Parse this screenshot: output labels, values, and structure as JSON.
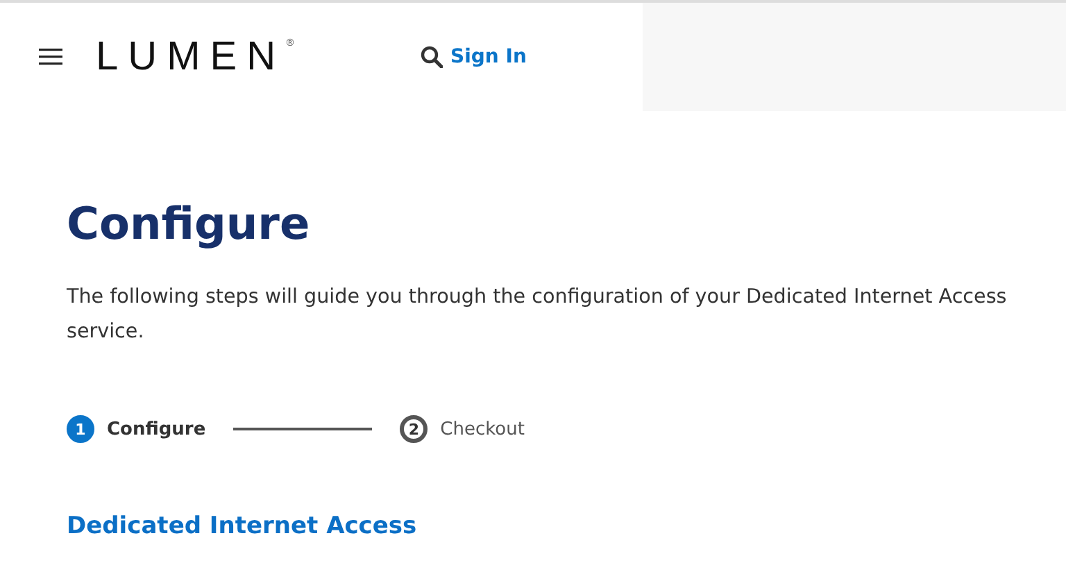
{
  "header": {
    "logo": "LUMEN",
    "logo_mark": "®",
    "sign_in": "Sign In"
  },
  "title": "Configure",
  "intro": "The following steps will guide you through the configuration of your Dedicated Internet Access service.",
  "steps": [
    {
      "number": "1",
      "label": "Configure",
      "selected": true
    },
    {
      "number": "2",
      "label": "Checkout",
      "selected": false
    }
  ],
  "section_title": "Dedicated Internet Access"
}
